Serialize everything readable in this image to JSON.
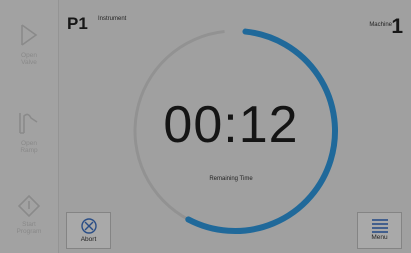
{
  "sidebar": {
    "items": [
      {
        "icon": "play-triangle-icon",
        "label_line1": "Open",
        "label_line2": "Valve"
      },
      {
        "icon": "pressure-curve-icon",
        "label_line1": "Open",
        "label_line2": "Ramp"
      },
      {
        "icon": "stop-diamond-icon",
        "label_line1": "Start",
        "label_line2": "Program"
      }
    ]
  },
  "header": {
    "program_id": "P1",
    "instrument_label": "Instrument",
    "machine_label": "Machine",
    "machine_number": "1"
  },
  "timer": {
    "value": "00:12",
    "caption": "Remaining Time",
    "progress_fraction": 0.58
  },
  "buttons": {
    "abort_label": "Abort",
    "menu_label": "Menu"
  },
  "colors": {
    "progress_arc": "#2f97dd",
    "track_arc": "#d2d2d2",
    "dim_overlay": "rgba(0,0,0,0.30)"
  }
}
